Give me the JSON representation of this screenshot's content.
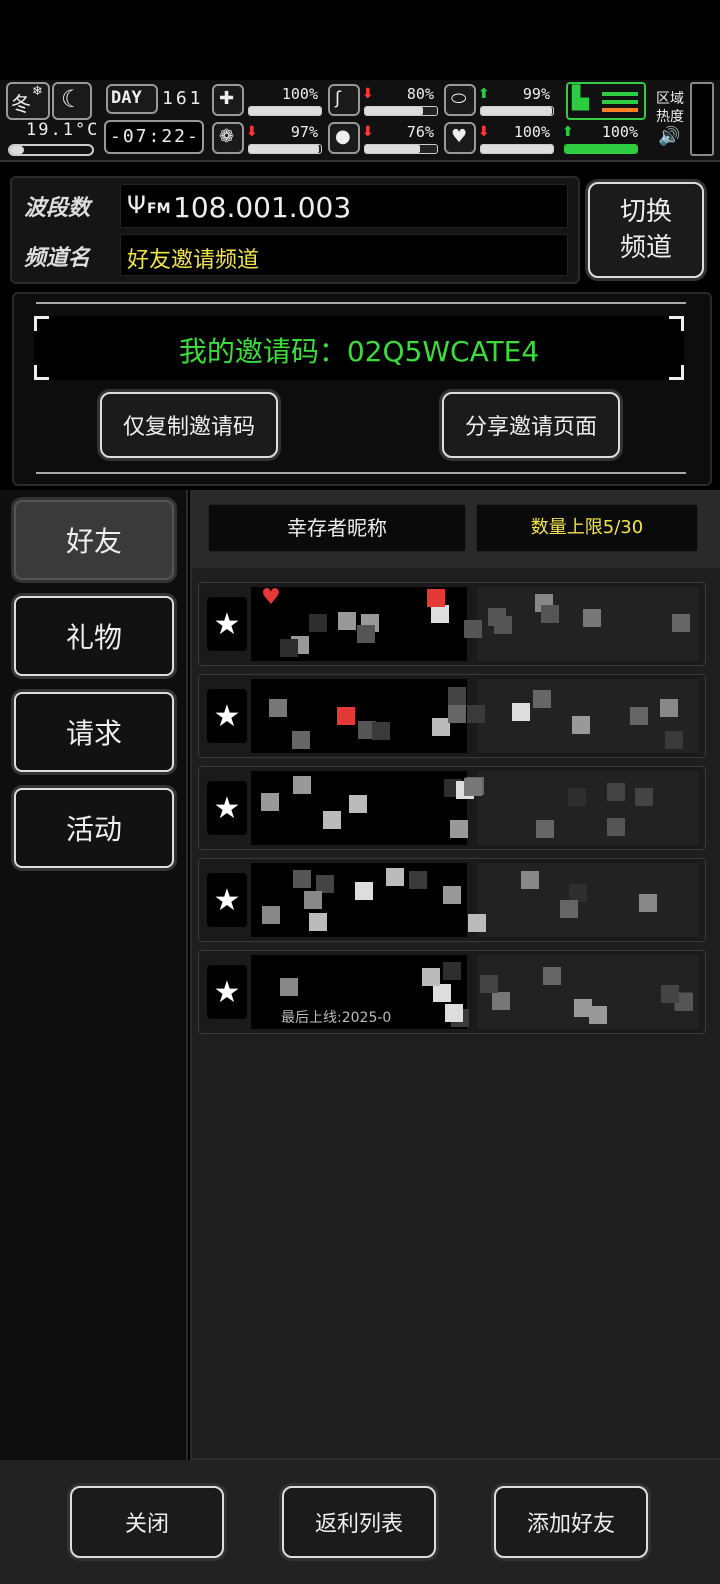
{
  "hud": {
    "season": "冬",
    "temperature": "19.1°C",
    "day_label": "DAY",
    "day_number": "161",
    "clock": "-07:22-",
    "zone_heat_label": "区域热度",
    "stats": [
      {
        "icon": "medkit-icon",
        "value": "100%",
        "arrow": "",
        "level": 1.0
      },
      {
        "icon": "stomach-icon",
        "value": "80%",
        "arrow": "down",
        "level": 0.8
      },
      {
        "icon": "pill-icon",
        "value": "99%",
        "arrow": "up",
        "level": 0.99
      },
      {
        "icon": "brain-icon",
        "value": "97%",
        "arrow": "down",
        "level": 0.97
      },
      {
        "icon": "water-drop-icon",
        "value": "76%",
        "arrow": "down",
        "level": 0.76
      },
      {
        "icon": "heart-icon",
        "value": "100%",
        "arrow": "down",
        "level": 1.0
      },
      {
        "icon": "boot-icon",
        "value": "100%",
        "arrow": "up",
        "level": 1.0
      }
    ],
    "colors": {
      "up": "#2ecc40",
      "down": "#ff3b30",
      "boot": "#2ecc40"
    }
  },
  "radio": {
    "band_label": "波段数",
    "band_value": "108.001.003",
    "fm_label": "FM",
    "channel_label": "频道名",
    "channel_value": "好友邀请频道",
    "switch_button": "切换频道"
  },
  "invite": {
    "code_text": "我的邀请码：02Q5WCATE4",
    "copy_button": "仅复制邀请码",
    "share_button": "分享邀请页面"
  },
  "tabs": [
    {
      "label": "好友",
      "active": true
    },
    {
      "label": "礼物",
      "active": false
    },
    {
      "label": "请求",
      "active": false
    },
    {
      "label": "活动",
      "active": false
    }
  ],
  "list_header": {
    "name_column": "幸存者昵称",
    "limit_text": "数量上限5/30"
  },
  "friends": [
    {
      "last_online": ""
    },
    {
      "last_online": ""
    },
    {
      "last_online": ""
    },
    {
      "last_online": ""
    },
    {
      "last_online": "最后上线:2025-0"
    }
  ],
  "footer": {
    "close_button": "关闭",
    "rebate_button": "返利列表",
    "add_friend_button": "添加好友"
  },
  "accent": {
    "green": "#3ddc3d",
    "yellow": "#f2e44b",
    "red": "#e53935"
  }
}
